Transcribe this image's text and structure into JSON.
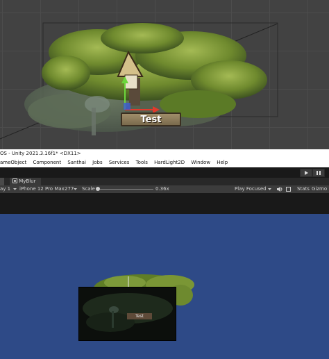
{
  "scene": {
    "nameplate_text": "Test"
  },
  "window": {
    "title": "OS - Unity 2021.3.16f1* <DX11>"
  },
  "menu": {
    "items": [
      "ameObject",
      "Component",
      "Santhai",
      "Jobs",
      "Services",
      "Tools",
      "HardLight2D",
      "Window",
      "Help"
    ]
  },
  "toolbar": {
    "play_icon": "play-icon",
    "pause_icon": "pause-icon"
  },
  "tabs": {
    "game_tab_icon": "game-icon",
    "myblur_label": "MyBlur"
  },
  "game_toolbar": {
    "display": "ay 1",
    "device": "iPhone 12 Pro Max",
    "resolution": "277",
    "scale_label": "Scale",
    "scale_value": "0.36x",
    "play_mode": "Play Focused",
    "stats": "Stats",
    "gizmos": "Gizmo"
  },
  "game": {
    "nameplate_text": "Test"
  },
  "colors": {
    "scene_bg": "#424242",
    "game_bg": "#2e4a87",
    "foliage": "#6f8a2e"
  }
}
